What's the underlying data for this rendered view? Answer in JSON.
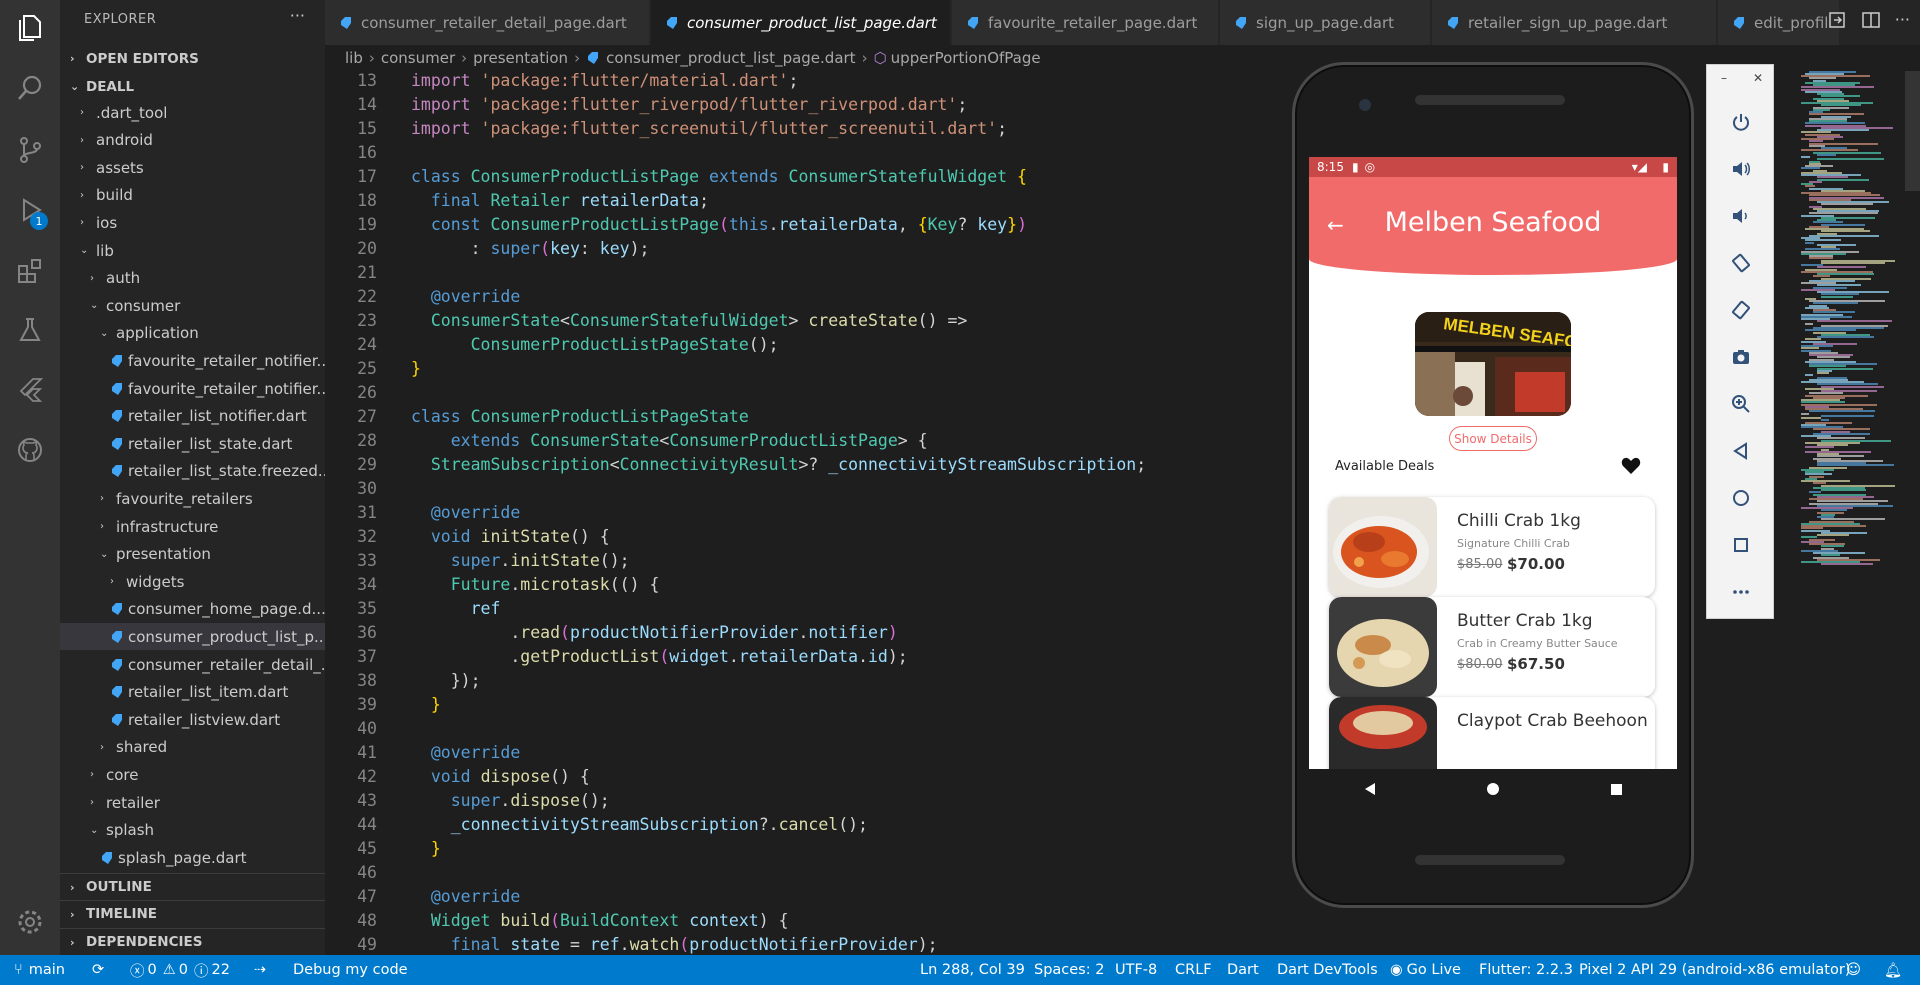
{
  "explorer": {
    "title": "EXPLORER",
    "more": "···",
    "sections": {
      "open_editors": "OPEN EDITORS",
      "project": "DEALL",
      "outline": "OUTLINE",
      "timeline": "TIMELINE",
      "dependencies": "DEPENDENCIES"
    },
    "tree": [
      {
        "label": ".dart_tool",
        "type": "folder"
      },
      {
        "label": "android",
        "type": "folder"
      },
      {
        "label": "assets",
        "type": "folder"
      },
      {
        "label": "build",
        "type": "folder"
      },
      {
        "label": "ios",
        "type": "folder"
      },
      {
        "label": "lib",
        "type": "folder-open"
      },
      {
        "label": "auth",
        "type": "folder"
      },
      {
        "label": "consumer",
        "type": "folder-open"
      },
      {
        "label": "application",
        "type": "folder-open"
      },
      {
        "label": "favourite_retailer_notifier...",
        "type": "dart"
      },
      {
        "label": "favourite_retailer_notifier...",
        "type": "dart"
      },
      {
        "label": "retailer_list_notifier.dart",
        "type": "dart"
      },
      {
        "label": "retailer_list_state.dart",
        "type": "dart"
      },
      {
        "label": "retailer_list_state.freezed....",
        "type": "dart"
      },
      {
        "label": "favourite_retailers",
        "type": "folder"
      },
      {
        "label": "infrastructure",
        "type": "folder"
      },
      {
        "label": "presentation",
        "type": "folder-open"
      },
      {
        "label": "widgets",
        "type": "folder"
      },
      {
        "label": "consumer_home_page.d...",
        "type": "dart"
      },
      {
        "label": "consumer_product_list_p...",
        "type": "dart"
      },
      {
        "label": "consumer_retailer_detail_...",
        "type": "dart"
      },
      {
        "label": "retailer_list_item.dart",
        "type": "dart"
      },
      {
        "label": "retailer_listview.dart",
        "type": "dart"
      },
      {
        "label": "shared",
        "type": "folder"
      },
      {
        "label": "core",
        "type": "folder"
      },
      {
        "label": "retailer",
        "type": "folder"
      },
      {
        "label": "splash",
        "type": "folder-open"
      },
      {
        "label": "splash_page.dart",
        "type": "dart"
      }
    ]
  },
  "activity_badge": "1",
  "tabs": [
    {
      "label": "consumer_retailer_detail_page.dart"
    },
    {
      "label": "consumer_product_list_page.dart",
      "close": "✕"
    },
    {
      "label": "favourite_retailer_page.dart"
    },
    {
      "label": "sign_up_page.dart"
    },
    {
      "label": "retailer_sign_up_page.dart"
    },
    {
      "label": "edit_profil"
    }
  ],
  "breadcrumb": {
    "parts": [
      "lib",
      "consumer",
      "presentation",
      "consumer_product_list_page.dart",
      "upperPortionOfPage"
    ]
  },
  "code": {
    "line_numbers": [
      "13",
      "14",
      "15",
      "16",
      "17",
      "18",
      "19",
      "20",
      "21",
      "22",
      "23",
      "24",
      "25",
      "26",
      "27",
      "28",
      "29",
      "30",
      "31",
      "32",
      "33",
      "34",
      "35",
      "36",
      "37",
      "38",
      "39",
      "40",
      "41",
      "42",
      "43",
      "44",
      "45",
      "46",
      "47",
      "48",
      "49"
    ],
    "lines": [
      [
        "import",
        " ",
        "'package:flutter/material.dart'",
        ";"
      ],
      [
        "import",
        " ",
        "'package:flutter_riverpod/flutter_riverpod.dart'",
        ";"
      ],
      [
        "import",
        " ",
        "'package:flutter_screenutil/flutter_screenutil.dart'",
        ";"
      ],
      [],
      [
        "class",
        " ",
        "ConsumerProductListPage",
        " ",
        "extends",
        " ",
        "ConsumerStatefulWidget",
        " ",
        "{"
      ],
      [
        "  ",
        "final",
        " ",
        "Retailer",
        " ",
        "retailerData",
        ";"
      ],
      [
        "  ",
        "const",
        " ",
        "ConsumerProductListPage",
        "(",
        "this",
        ".",
        "retailerData",
        ", ",
        "{",
        "Key",
        "? ",
        "key",
        "}",
        ")"
      ],
      [
        "      ",
        ": ",
        "super",
        "(",
        "key",
        ": ",
        "key",
        ");"
      ],
      [],
      [
        "  ",
        "@override"
      ],
      [
        "  ",
        "ConsumerState",
        "<",
        "ConsumerStatefulWidget",
        "> ",
        "createState",
        "() =>"
      ],
      [
        "      ",
        "ConsumerProductListPageState",
        "();"
      ],
      [
        "}"
      ],
      [],
      [
        "class",
        " ",
        "ConsumerProductListPageState"
      ],
      [
        "    ",
        "extends",
        " ",
        "ConsumerState",
        "<",
        "ConsumerProductListPage",
        "> {"
      ],
      [
        "  ",
        "StreamSubscription",
        "<",
        "ConnectivityResult",
        ">? ",
        "_connectivityStreamSubscription",
        ";"
      ],
      [],
      [
        "  ",
        "@override"
      ],
      [
        "  ",
        "void",
        " ",
        "initState",
        "() {"
      ],
      [
        "    ",
        "super",
        ".",
        "initState",
        "();"
      ],
      [
        "    ",
        "Future",
        ".",
        "microtask",
        "(() {"
      ],
      [
        "      ",
        "ref"
      ],
      [
        "          ",
        ".",
        "read",
        "(",
        "productNotifierProvider",
        ".",
        "notifier",
        ")"
      ],
      [
        "          ",
        ".",
        "getProductList",
        "(",
        "widget",
        ".",
        "retailerData",
        ".",
        "id",
        ");"
      ],
      [
        "    ",
        "});"
      ],
      [
        "  ",
        "}"
      ],
      [],
      [
        "  ",
        "@override"
      ],
      [
        "  ",
        "void",
        " ",
        "dispose",
        "() {"
      ],
      [
        "    ",
        "super",
        ".",
        "dispose",
        "();"
      ],
      [
        "    ",
        "_connectivityStreamSubscription",
        "?.",
        "cancel",
        "();"
      ],
      [
        "  ",
        "}"
      ],
      [],
      [
        "  ",
        "@override"
      ],
      [
        "  ",
        "Widget",
        " ",
        "build",
        "(",
        "BuildContext",
        " ",
        "context",
        ") {"
      ],
      [
        "    ",
        "final",
        " ",
        "state",
        " = ",
        "ref",
        ".",
        "watch",
        "(",
        "productNotifierProvider",
        ");"
      ]
    ]
  },
  "phone": {
    "time": "8:15",
    "title": "Melben Seafood",
    "back": "←",
    "show_details": "Show Details",
    "available_deals": "Available Deals",
    "storefront_sign": "MELBEN SEAFOOD",
    "products": [
      {
        "name": "Chilli Crab 1kg",
        "desc": "Signature Chilli Crab",
        "old_price": "$85.00",
        "new_price": "$70.00"
      },
      {
        "name": "Butter Crab 1kg",
        "desc": "Crab in Creamy Butter Sauce",
        "old_price": "$80.00",
        "new_price": "$67.50"
      },
      {
        "name": "Claypot Crab Beehoon",
        "desc": "",
        "old_price": "",
        "new_price": ""
      }
    ],
    "colors": {
      "app_bar": "#f26b6b",
      "status_bar": "#c84848"
    }
  },
  "emulator": {
    "minimize": "–",
    "close": "✕",
    "buttons": [
      "power-icon",
      "volume-up-icon",
      "volume-down-icon",
      "rotate-left-icon",
      "rotate-right-icon",
      "camera-icon",
      "zoom-icon",
      "back-icon",
      "home-icon",
      "overview-icon",
      "more-icon"
    ]
  },
  "statusbar": {
    "branch": "main",
    "errors": "0",
    "warnings": "0",
    "infos": "22",
    "debug": "Debug my code",
    "position": "Ln 288, Col 39",
    "spaces": "Spaces: 2",
    "encoding": "UTF-8",
    "eol": "CRLF",
    "language": "Dart",
    "devtools": "Dart DevTools",
    "golive": "Go Live",
    "flutter": "Flutter: 2.2.3",
    "device": "Pixel 2 API 29 (android-x86 emulator)",
    "accent": "#007acc"
  }
}
